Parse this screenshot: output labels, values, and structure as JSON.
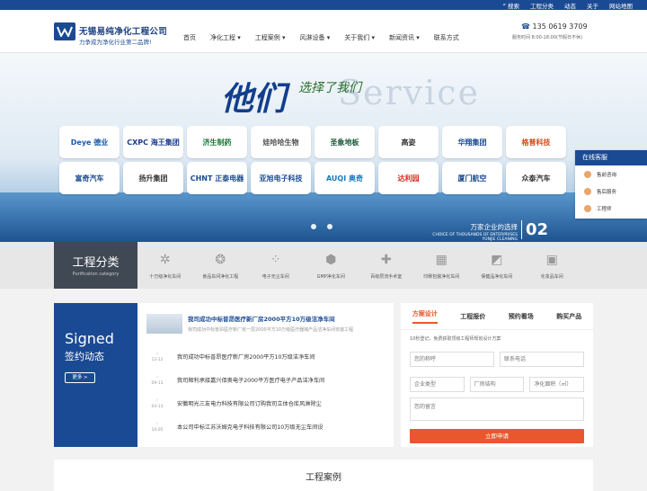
{
  "topbar": {
    "links": [
      "搜索",
      "工程分类",
      "动态",
      "关于",
      "网站地图"
    ]
  },
  "header": {
    "company": "无锡易纯净化工程公司",
    "slogan": "力争成为净化行业第二品牌!",
    "nav": [
      "首页",
      "净化工程",
      "工程案例",
      "风淋设备",
      "关于我们",
      "新闻资讯",
      "联系方式"
    ],
    "phone": "135 0619 3709",
    "hours": "服务时间 8:00-18:00(节假日不休)"
  },
  "banner": {
    "headline": "他们",
    "sub_headline": "选择了我们",
    "service_text": "Service",
    "brands": [
      "Deye 德业",
      "CXPC 海王集团",
      "济生制药",
      "娃哈哈生物",
      "圣象地板",
      "高姿",
      "华翔集团",
      "格普科技",
      "富奇汽车",
      "扬升集团",
      "CHNT 正泰电器",
      "亚旭电子科技",
      "AUQI 奥奇",
      "达利园",
      "厦门航空",
      "众泰汽车"
    ],
    "choice": "万家企业的选择",
    "choice_sub": "CHOICE OF THOUSANDS OF ENTERPRISES YUNJIE CLEANING",
    "choice_num": "02"
  },
  "kefu": {
    "title": "在线客服",
    "items": [
      "售前咨询",
      "售后服务",
      "工程师"
    ]
  },
  "categories": {
    "title": "工程分类",
    "subtitle": "Purification category",
    "items": [
      "十万级净化车间",
      "食品车间净化工程",
      "电子无尘车间",
      "GMP净化车间",
      "百级层流手术室",
      "印刷包装净化车间",
      "保健品净化车间",
      "化妆品车间"
    ]
  },
  "signed": {
    "en": "Signed",
    "cn": "签约动态",
    "more": "更多 >"
  },
  "news": {
    "featured_title": "我司成功中标普昂医疗新厂房2000平方10万级洁净车间",
    "featured_desc": "我司成功中标普昂医疗新厂房一层2000平方10万级医疗器械产品洁净车间安装工程",
    "items": [
      {
        "date": "12-12",
        "title": "我司成功中标普昂医疗新厂房2000平方10万级洁净车间"
      },
      {
        "date": "09-13",
        "title": "我司顺利承接嘉兴佰奥电子2000平方医疗电子产品洁净车间"
      },
      {
        "date": "04-13",
        "title": "安徽明光三友电力科技有限公司订购我司立体仓库风淋除尘"
      },
      {
        "date": "10-05",
        "title": "本公司中标江苏沃姆克电子科技有限公司10万级无尘车间设"
      }
    ]
  },
  "form": {
    "tabs": [
      "方案设计",
      "工程报价",
      "预约看场",
      "购买产品"
    ],
    "tip": "10秒登记，免费获取顶级工程师规划设计方案",
    "placeholders": {
      "name": "您的称呼",
      "phone": "联系电话",
      "type": "企业类型",
      "structure": "厂房结构",
      "area": "净化面积（㎡）",
      "message": "您的留言"
    },
    "submit": "立即申请"
  },
  "cases": {
    "title": "工程案例"
  }
}
